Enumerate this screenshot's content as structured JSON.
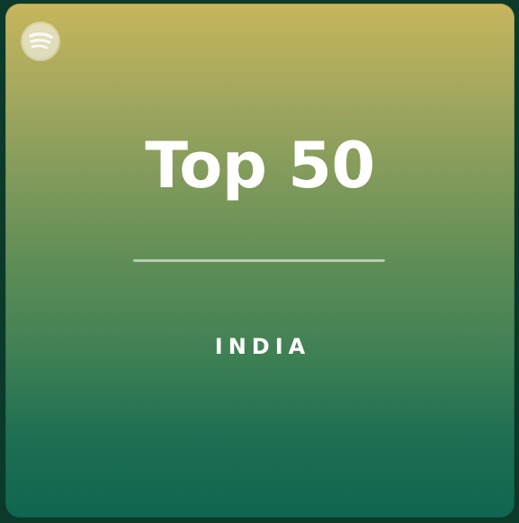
{
  "cover": {
    "title": "Top 50",
    "subtitle": "INDIA",
    "logo_icon": "spotify-icon",
    "gradient": [
      "#c7b65d",
      "#9aa45e",
      "#6a9158",
      "#3f8054",
      "#1d6e53",
      "#0f6650"
    ]
  }
}
